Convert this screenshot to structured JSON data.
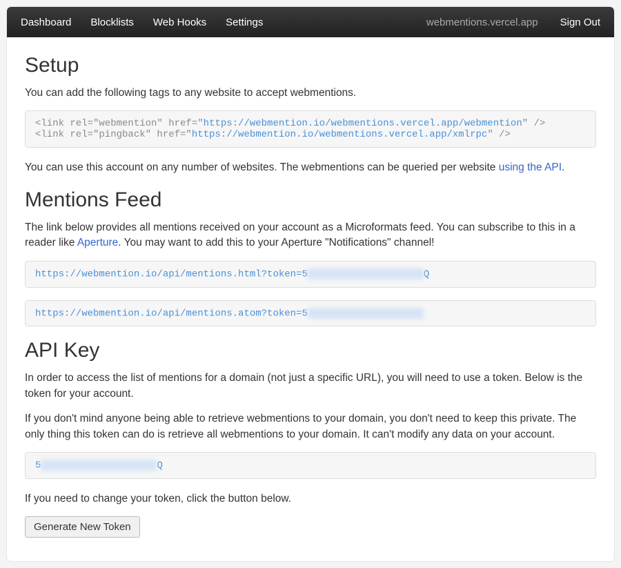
{
  "nav": {
    "left": [
      {
        "label": "Dashboard"
      },
      {
        "label": "Blocklists"
      },
      {
        "label": "Web Hooks"
      },
      {
        "label": "Settings"
      }
    ],
    "domain": "webmentions.vercel.app",
    "signout": "Sign Out"
  },
  "setup": {
    "heading": "Setup",
    "intro": "You can add the following tags to any website to accept webmentions.",
    "code_line1_prefix": "<link rel=\"webmention\" href=\"",
    "code_line1_url": "https://webmention.io/webmentions.vercel.app/webmention",
    "code_line1_suffix": "\" />",
    "code_line2_prefix": "<link rel=\"pingback\" href=\"",
    "code_line2_url": "https://webmention.io/webmentions.vercel.app/xmlrpc",
    "code_line2_suffix": "\" />",
    "para2_a": "You can use this account on any number of websites. The webmentions can be queried per website ",
    "para2_link": "using the API",
    "para2_b": "."
  },
  "feed": {
    "heading": "Mentions Feed",
    "para1_a": "The link below provides all mentions received on your account as a Microformats feed. You can subscribe to this in a reader like ",
    "para1_link": "Aperture",
    "para1_b": ". You may want to add this to your Aperture \"Notifications\" channel!",
    "url_html_prefix": "https://webmention.io/api/mentions.html?token=5",
    "url_html_redacted": "xxxxxxxxxxxxxxxxxxxx",
    "url_html_suffix": "Q",
    "url_atom_prefix": "https://webmention.io/api/mentions.atom?token=5",
    "url_atom_redacted": "xxxxxxxxxxxxxxxxxxxx",
    "url_atom_suffix": ""
  },
  "apikey": {
    "heading": "API Key",
    "para1": "In order to access the list of mentions for a domain (not just a specific URL), you will need to use a token. Below is the token for your account.",
    "para2": "If you don't mind anyone being able to retrieve webmentions to your domain, you don't need to keep this private. The only thing this token can do is retrieve all webmentions to your domain. It can't modify any data on your account.",
    "token_prefix": "5",
    "token_redacted": "xxxxxxxxxxxxxxxxxxxx",
    "token_suffix": "Q",
    "para3": "If you need to change your token, click the button below.",
    "button": "Generate New Token"
  }
}
